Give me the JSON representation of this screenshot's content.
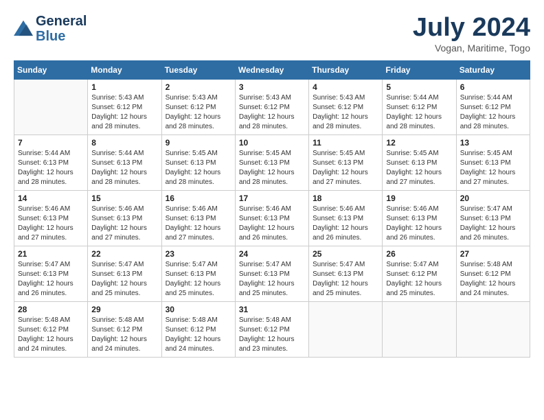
{
  "header": {
    "logo_line1": "General",
    "logo_line2": "Blue",
    "month": "July 2024",
    "location": "Vogan, Maritime, Togo"
  },
  "weekdays": [
    "Sunday",
    "Monday",
    "Tuesday",
    "Wednesday",
    "Thursday",
    "Friday",
    "Saturday"
  ],
  "weeks": [
    [
      {
        "day": "",
        "info": ""
      },
      {
        "day": "1",
        "info": "Sunrise: 5:43 AM\nSunset: 6:12 PM\nDaylight: 12 hours\nand 28 minutes."
      },
      {
        "day": "2",
        "info": "Sunrise: 5:43 AM\nSunset: 6:12 PM\nDaylight: 12 hours\nand 28 minutes."
      },
      {
        "day": "3",
        "info": "Sunrise: 5:43 AM\nSunset: 6:12 PM\nDaylight: 12 hours\nand 28 minutes."
      },
      {
        "day": "4",
        "info": "Sunrise: 5:43 AM\nSunset: 6:12 PM\nDaylight: 12 hours\nand 28 minutes."
      },
      {
        "day": "5",
        "info": "Sunrise: 5:44 AM\nSunset: 6:12 PM\nDaylight: 12 hours\nand 28 minutes."
      },
      {
        "day": "6",
        "info": "Sunrise: 5:44 AM\nSunset: 6:12 PM\nDaylight: 12 hours\nand 28 minutes."
      }
    ],
    [
      {
        "day": "7",
        "info": "Sunrise: 5:44 AM\nSunset: 6:13 PM\nDaylight: 12 hours\nand 28 minutes."
      },
      {
        "day": "8",
        "info": "Sunrise: 5:44 AM\nSunset: 6:13 PM\nDaylight: 12 hours\nand 28 minutes."
      },
      {
        "day": "9",
        "info": "Sunrise: 5:45 AM\nSunset: 6:13 PM\nDaylight: 12 hours\nand 28 minutes."
      },
      {
        "day": "10",
        "info": "Sunrise: 5:45 AM\nSunset: 6:13 PM\nDaylight: 12 hours\nand 28 minutes."
      },
      {
        "day": "11",
        "info": "Sunrise: 5:45 AM\nSunset: 6:13 PM\nDaylight: 12 hours\nand 27 minutes."
      },
      {
        "day": "12",
        "info": "Sunrise: 5:45 AM\nSunset: 6:13 PM\nDaylight: 12 hours\nand 27 minutes."
      },
      {
        "day": "13",
        "info": "Sunrise: 5:45 AM\nSunset: 6:13 PM\nDaylight: 12 hours\nand 27 minutes."
      }
    ],
    [
      {
        "day": "14",
        "info": "Sunrise: 5:46 AM\nSunset: 6:13 PM\nDaylight: 12 hours\nand 27 minutes."
      },
      {
        "day": "15",
        "info": "Sunrise: 5:46 AM\nSunset: 6:13 PM\nDaylight: 12 hours\nand 27 minutes."
      },
      {
        "day": "16",
        "info": "Sunrise: 5:46 AM\nSunset: 6:13 PM\nDaylight: 12 hours\nand 27 minutes."
      },
      {
        "day": "17",
        "info": "Sunrise: 5:46 AM\nSunset: 6:13 PM\nDaylight: 12 hours\nand 26 minutes."
      },
      {
        "day": "18",
        "info": "Sunrise: 5:46 AM\nSunset: 6:13 PM\nDaylight: 12 hours\nand 26 minutes."
      },
      {
        "day": "19",
        "info": "Sunrise: 5:46 AM\nSunset: 6:13 PM\nDaylight: 12 hours\nand 26 minutes."
      },
      {
        "day": "20",
        "info": "Sunrise: 5:47 AM\nSunset: 6:13 PM\nDaylight: 12 hours\nand 26 minutes."
      }
    ],
    [
      {
        "day": "21",
        "info": "Sunrise: 5:47 AM\nSunset: 6:13 PM\nDaylight: 12 hours\nand 26 minutes."
      },
      {
        "day": "22",
        "info": "Sunrise: 5:47 AM\nSunset: 6:13 PM\nDaylight: 12 hours\nand 25 minutes."
      },
      {
        "day": "23",
        "info": "Sunrise: 5:47 AM\nSunset: 6:13 PM\nDaylight: 12 hours\nand 25 minutes."
      },
      {
        "day": "24",
        "info": "Sunrise: 5:47 AM\nSunset: 6:13 PM\nDaylight: 12 hours\nand 25 minutes."
      },
      {
        "day": "25",
        "info": "Sunrise: 5:47 AM\nSunset: 6:13 PM\nDaylight: 12 hours\nand 25 minutes."
      },
      {
        "day": "26",
        "info": "Sunrise: 5:47 AM\nSunset: 6:12 PM\nDaylight: 12 hours\nand 25 minutes."
      },
      {
        "day": "27",
        "info": "Sunrise: 5:48 AM\nSunset: 6:12 PM\nDaylight: 12 hours\nand 24 minutes."
      }
    ],
    [
      {
        "day": "28",
        "info": "Sunrise: 5:48 AM\nSunset: 6:12 PM\nDaylight: 12 hours\nand 24 minutes."
      },
      {
        "day": "29",
        "info": "Sunrise: 5:48 AM\nSunset: 6:12 PM\nDaylight: 12 hours\nand 24 minutes."
      },
      {
        "day": "30",
        "info": "Sunrise: 5:48 AM\nSunset: 6:12 PM\nDaylight: 12 hours\nand 24 minutes."
      },
      {
        "day": "31",
        "info": "Sunrise: 5:48 AM\nSunset: 6:12 PM\nDaylight: 12 hours\nand 23 minutes."
      },
      {
        "day": "",
        "info": ""
      },
      {
        "day": "",
        "info": ""
      },
      {
        "day": "",
        "info": ""
      }
    ]
  ]
}
